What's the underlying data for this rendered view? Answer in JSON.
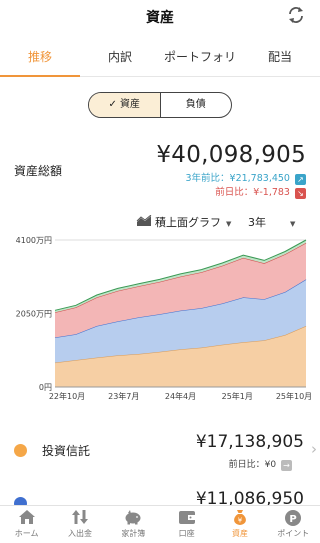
{
  "header": {
    "title": "資産"
  },
  "tabs": [
    {
      "label": "推移"
    },
    {
      "label": "内訳"
    },
    {
      "label": "ポートフォリオ"
    },
    {
      "label": "配当"
    }
  ],
  "toggle": {
    "assets": "✓ 資産",
    "liabilities": "負債"
  },
  "summary": {
    "label": "資産総額",
    "value": "¥40,098,905",
    "three_year": "3年前比：¥21,783,450",
    "prev_day": "前日比：¥-1,783"
  },
  "chart_controls": {
    "type": "積上面グラフ",
    "period": "3年"
  },
  "chart_data": {
    "type": "area",
    "yticks": [
      "4100万円",
      "2050万円",
      "0円"
    ],
    "xticks": [
      "22年10月",
      "23年7月",
      "24年4月",
      "25年1月",
      "25年10月"
    ],
    "ylim": [
      0,
      4100
    ],
    "x": [
      "22年10月",
      "23年1月",
      "23年4月",
      "23年7月",
      "23年10月",
      "24年1月",
      "24年4月",
      "24年7月",
      "24年10月",
      "25年1月",
      "25年4月",
      "25年7月",
      "25年10月"
    ],
    "series": [
      {
        "color": "#f6cfa4",
        "values": [
          680,
          750,
          820,
          880,
          920,
          980,
          1050,
          1100,
          1180,
          1250,
          1300,
          1450,
          1700
        ]
      },
      {
        "color": "#b7cdee",
        "values": [
          700,
          720,
          880,
          950,
          1020,
          1050,
          1080,
          1100,
          1150,
          1250,
          1150,
          1200,
          1300
        ]
      },
      {
        "color": "#f3b6b6",
        "values": [
          700,
          750,
          800,
          850,
          870,
          900,
          950,
          1000,
          1050,
          1100,
          1000,
          1050,
          1020
        ]
      },
      {
        "color": "#bfe3c6",
        "values": [
          60,
          60,
          65,
          70,
          70,
          72,
          75,
          75,
          78,
          80,
          80,
          80,
          80
        ]
      }
    ]
  },
  "holdings": [
    {
      "name": "投資信託",
      "value": "¥17,138,905",
      "prev_day": "前日比：¥0",
      "color": "#f5a748"
    },
    {
      "name": "",
      "value": "¥11,086,950",
      "prev_day": "",
      "color": "#3f6fcf"
    }
  ],
  "nav": [
    {
      "label": "ホーム",
      "icon": "home-icon"
    },
    {
      "label": "入出金",
      "icon": "transfer-icon"
    },
    {
      "label": "家計簿",
      "icon": "piggy-bank-icon"
    },
    {
      "label": "口座",
      "icon": "wallet-icon"
    },
    {
      "label": "資産",
      "icon": "asset-bag-icon"
    },
    {
      "label": "ポイント",
      "icon": "points-icon"
    }
  ]
}
